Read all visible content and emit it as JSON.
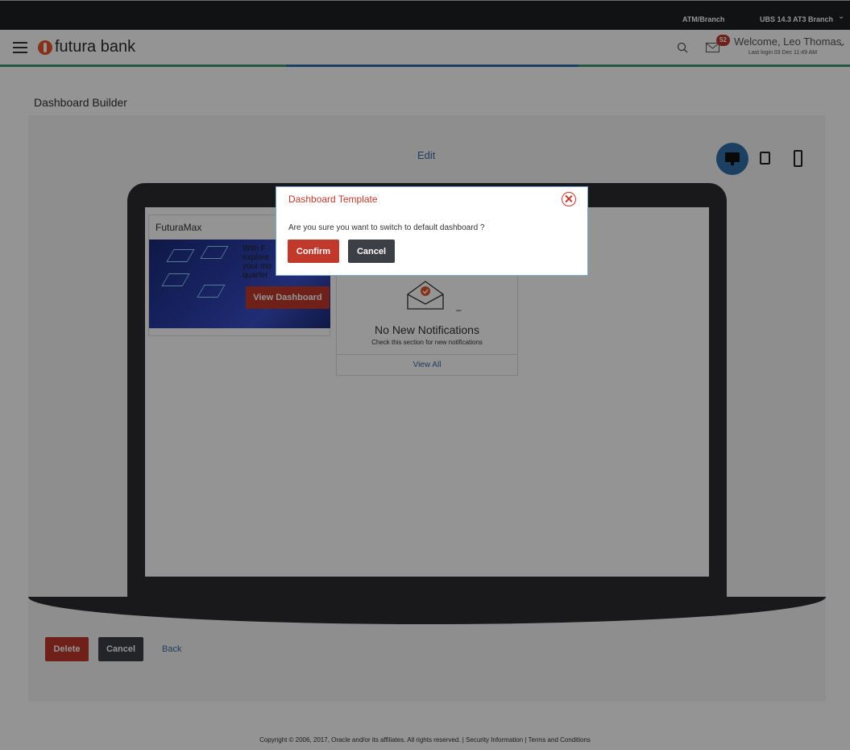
{
  "topbar": {
    "atm_label": "ATM/Branch",
    "branch_label": "UBS 14.3 AT3 Branch"
  },
  "header": {
    "logo_text": "futura bank",
    "notification_count": "52",
    "welcome_text": "Welcome, Leo Thomas",
    "last_login": "Last login 03 Dec 11:49 AM"
  },
  "page": {
    "title": "Dashboard Builder",
    "edit_label": "Edit"
  },
  "widgets": {
    "futuramax": {
      "title": "FuturaMax",
      "partial_text": "With F\nexplore\nyour mo\nquarter",
      "button_label": "View Dashboard"
    },
    "notifications": {
      "title": "No New Notifications",
      "subtitle": "Check this section for new notifications",
      "link_label": "View All",
      "dash_glyph": "–"
    }
  },
  "actions": {
    "delete_label": "Delete",
    "cancel_label": "Cancel",
    "back_label": "Back"
  },
  "footer": {
    "text": "Copyright © 2006, 2017, Oracle and/or its affiliates. All rights reserved. | Security Information | Terms and Conditions"
  },
  "modal": {
    "title": "Dashboard Template",
    "message": "Are you sure you want to switch to default dashboard ?",
    "confirm_label": "Confirm",
    "cancel_label": "Cancel"
  },
  "colors": {
    "accent_red": "#c0392b",
    "primary_blue": "#2f6fa8",
    "dark_button": "#3d3f46",
    "topbar": "#1e1f22"
  }
}
